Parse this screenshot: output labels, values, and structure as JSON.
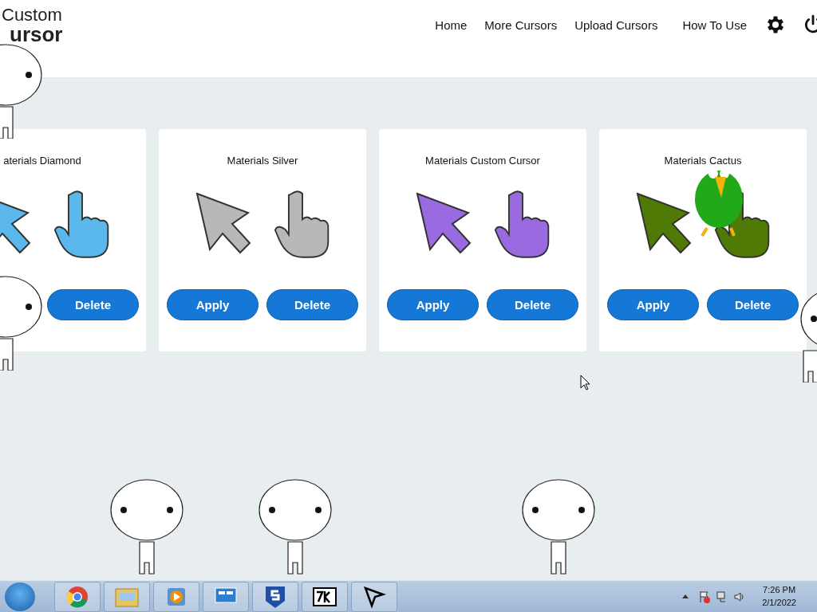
{
  "logo": {
    "line_1": "Custom",
    "line_2": "ursor"
  },
  "nav": [
    "Home",
    "More Cursors",
    "Upload Cursors",
    "How To Use"
  ],
  "cards": [
    {
      "title": "aterials Diamond",
      "color": "#5bb8ec",
      "delete": "Delete"
    },
    {
      "title": "Materials Silver",
      "color": "#b8b8b8",
      "apply": "Apply",
      "delete": "Delete"
    },
    {
      "title": "Materials Custom Cursor",
      "color": "#9a6ae0",
      "apply": "Apply",
      "delete": "Delete"
    },
    {
      "title": "Materials Cactus",
      "color": "#4f7a06",
      "apply": "Apply",
      "delete": "Delete"
    }
  ],
  "taskbar": {
    "time": "7:26 PM",
    "date": "2/1/2022"
  }
}
